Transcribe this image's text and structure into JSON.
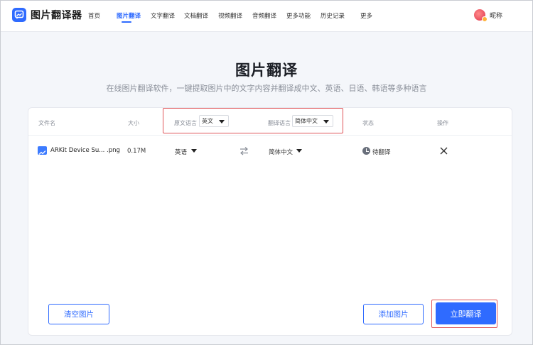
{
  "app": {
    "name": "图片翻译器",
    "logo_icon": "chat-image-icon"
  },
  "nav": {
    "items": [
      {
        "label": "首页"
      },
      {
        "label": "图片翻译",
        "active": true
      },
      {
        "label": "文字翻译"
      },
      {
        "label": "文档翻译"
      },
      {
        "label": "视频翻译"
      },
      {
        "label": "音频翻译"
      },
      {
        "label": "更多功能"
      },
      {
        "label": "历史记录"
      },
      {
        "label": "更多"
      }
    ],
    "user": {
      "name": "昵称",
      "avatar_icon": "avatar"
    }
  },
  "hero": {
    "title": "图片翻译",
    "subtitle": "在线图片翻译软件，一键提取图片中的文字内容并翻译成中文、英语、日语、韩语等多种语言"
  },
  "table": {
    "headers": {
      "filename": "文件名",
      "size": "大小",
      "source_lang": "原文语言",
      "target_lang": "翻译语言",
      "status": "状态",
      "actions": "操作"
    },
    "header_source_value": "英文",
    "header_target_value": "简体中文",
    "rows": [
      {
        "file_name": "ARKit Device Su... .png",
        "size": "0.17M",
        "source_lang": "英语",
        "target_lang": "简体中文",
        "status": "待翻译",
        "file_icon": "image-file-icon",
        "swap_icon": "swap-icon",
        "status_icon": "clock-icon",
        "delete_icon": "close-icon"
      }
    ]
  },
  "buttons": {
    "clear": "清空图片",
    "add": "添加图片",
    "translate": "立即翻译"
  },
  "colors": {
    "accent": "#2f6bff",
    "highlight_border": "#e0565a",
    "page_bg": "#f4f6fa"
  }
}
